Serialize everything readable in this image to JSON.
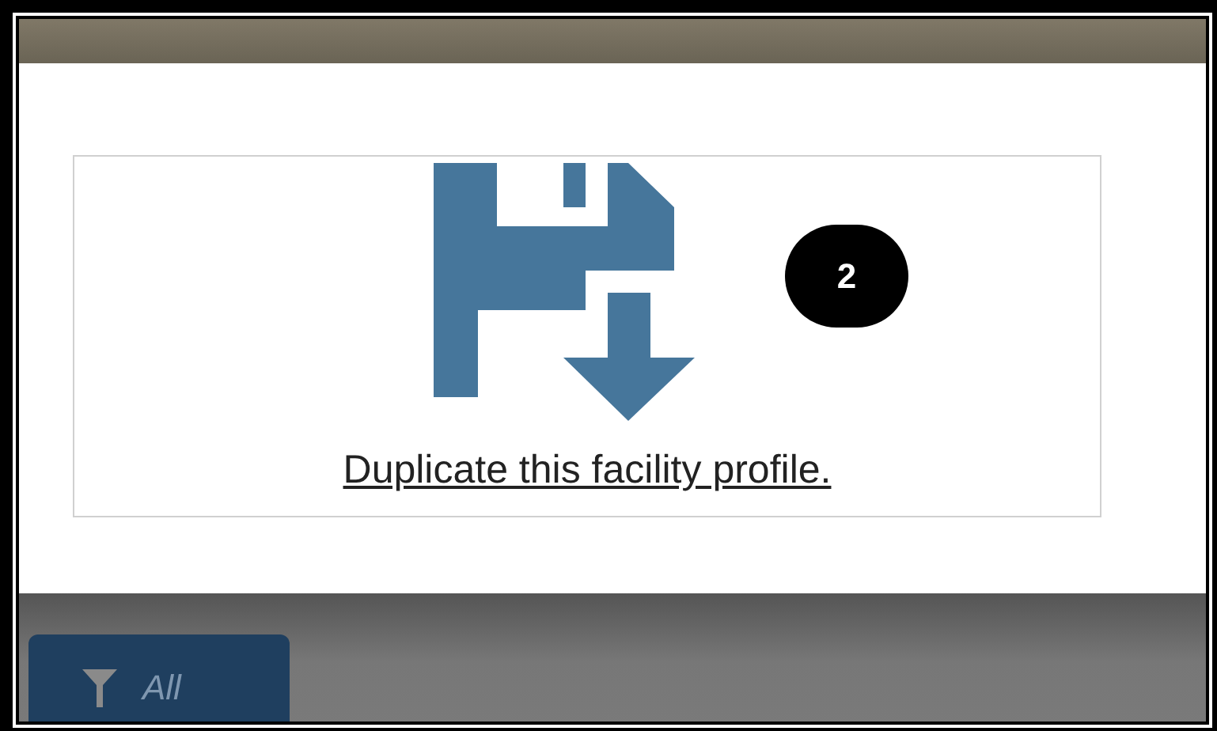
{
  "link": {
    "text": "Duplicate this facility profile."
  },
  "callout": {
    "text": "2"
  },
  "filter_tab": {
    "label": "All"
  }
}
